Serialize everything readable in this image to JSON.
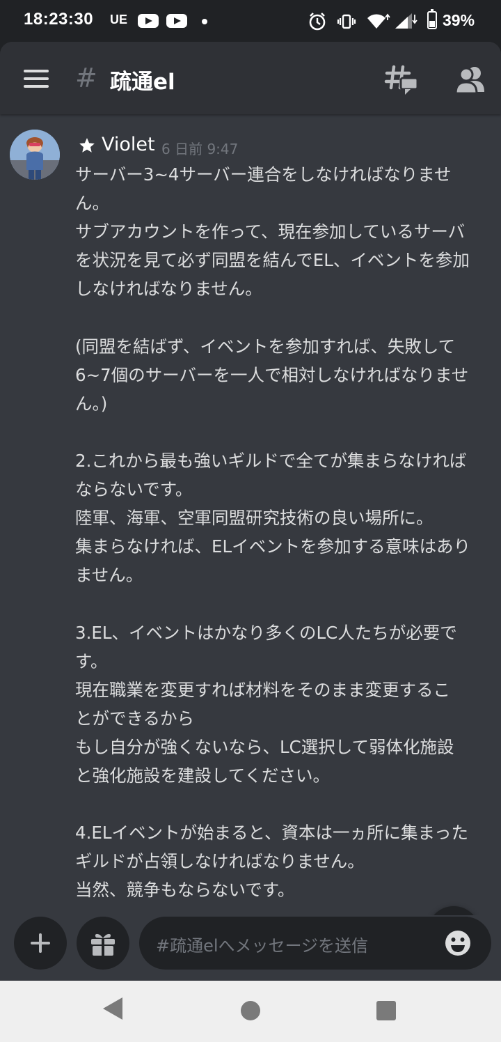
{
  "status_bar": {
    "time": "18:23:30",
    "carrier": "UE",
    "battery": "39%"
  },
  "header": {
    "hash_symbol": "#",
    "channel_name": "疏通el"
  },
  "message": {
    "author": "Violet",
    "timestamp": "6 日前 9:47",
    "lines": [
      "サーバー3~4サーバー連合をしなければなりませ",
      "ん。",
      "サブアカウントを作って、現在参加しているサーバ",
      "を状況を見て必ず同盟を結んでEL、イベントを参加",
      "しなければなりません。",
      "",
      "(同盟を結ばず、イベントを参加すれば、失敗して",
      "6~7個のサーバーを一人で相対しなければなりませ",
      "ん。)",
      "",
      "2.これから最も強いギルドで全てが集まらなければ",
      "ならないです。",
      "陸軍、海軍、空軍同盟研究技術の良い場所に。",
      "集まらなければ、ELイベントを参加する意味はあり",
      "ません。",
      "",
      "3.EL、イベントはかなり多くのLC人たちが必要で",
      "す。",
      "現在職業を変更すれば材料をそのまま変更するこ",
      "とができるから",
      "もし自分が強くないなら、LC選択して弱体化施設",
      "と強化施設を建設してください。",
      "",
      "4.ELイベントが始まると、資本は一ヵ所に集まった",
      "ギルドが占領しなければなりません。",
      "当然、競争もならないです。"
    ]
  },
  "composer": {
    "placeholder": "#疏通elへメッセージを送信"
  },
  "icons": {
    "menu": "hamburger-menu-icon",
    "threads": "threads-icon",
    "members": "members-icon",
    "add": "plus-icon",
    "gift": "gift-icon",
    "emoji": "emoji-icon",
    "scroll": "chevron-down-icon"
  },
  "colors": {
    "background": "#36393f",
    "header": "#2f3136",
    "dark": "#202225",
    "text": "#dcddde",
    "muted": "#72767d"
  }
}
